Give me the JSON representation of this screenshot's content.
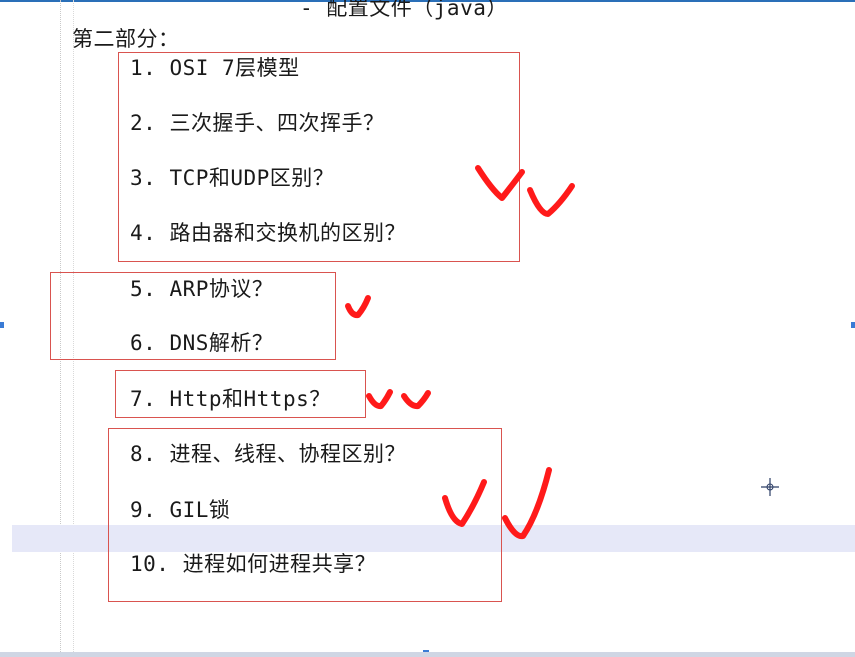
{
  "document": {
    "title": "- 配置文件（java）",
    "section_heading": "第二部分：",
    "items": [
      {
        "num": "1.",
        "text": "OSI 7层模型"
      },
      {
        "num": "2.",
        "text": "三次握手、四次挥手？"
      },
      {
        "num": "3.",
        "text": "TCP和UDP区别？"
      },
      {
        "num": "4.",
        "text": "路由器和交换机的区别？"
      },
      {
        "num": "5.",
        "text": "ARP协议？"
      },
      {
        "num": "6.",
        "text": "DNS解析？"
      },
      {
        "num": "7.",
        "text": "Http和Https？"
      },
      {
        "num": "8.",
        "text": "进程、线程、协程区别？"
      },
      {
        "num": "9.",
        "text": "GIL锁"
      },
      {
        "num": "10.",
        "text": "进程如何进程共享？"
      }
    ]
  },
  "annotations": {
    "box_color": "#d9534f",
    "check_color": "#ff1a1a",
    "cursor_icon": "crosshair-icon"
  }
}
